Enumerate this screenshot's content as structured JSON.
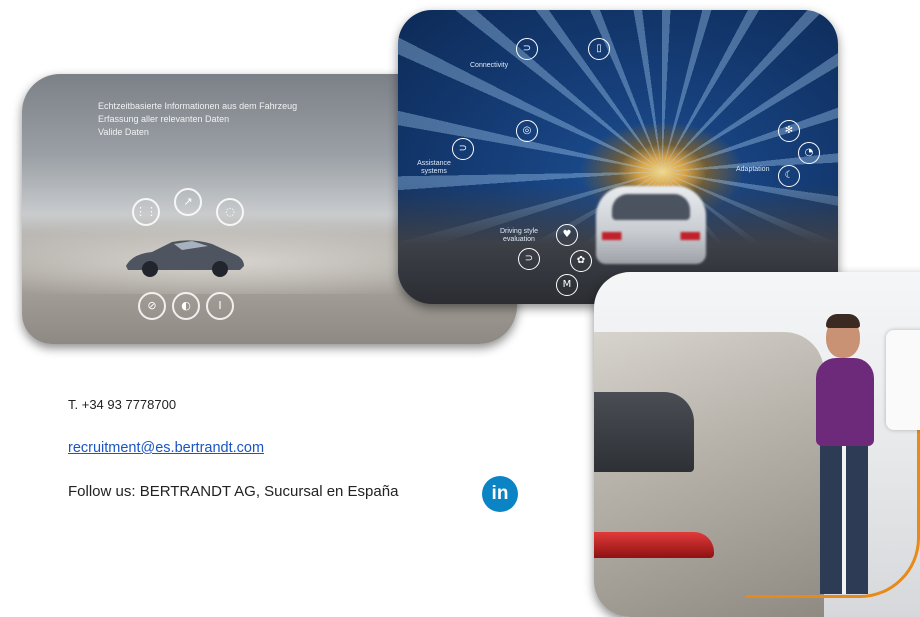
{
  "desert_card": {
    "lines": [
      "Echtzeitbasierte Informationen aus dem Fahrzeug",
      "Erfassung aller relevanten Daten",
      "Valide Daten"
    ],
    "icons": [
      "gauge-icon",
      "compass-icon",
      "tire-icon",
      "piston-icon",
      "rpm-icon",
      "thermometer-icon"
    ]
  },
  "tunnel_card": {
    "labels": {
      "connectivity": "Connectivity",
      "assistance": "Assistance systems",
      "adaptation": "Adaptation",
      "driving_style": "Driving style evaluation"
    },
    "icons": [
      "car-signal-icon",
      "phone-icon",
      "steering-icon",
      "car-wifi-icon",
      "snowflake-icon",
      "chart-icon",
      "leaf-icon",
      "fuel-icon",
      "heart-icon",
      "road-icon"
    ]
  },
  "contact": {
    "phone": "T. +34 93 7778700",
    "email": "recruitment@es.bertrandt.com",
    "follow": "Follow us: BERTRANDT AG, Sucursal en España",
    "linkedin_label": "in"
  },
  "colors": {
    "link": "#1a55c4",
    "linkedin": "#0a84c4"
  }
}
